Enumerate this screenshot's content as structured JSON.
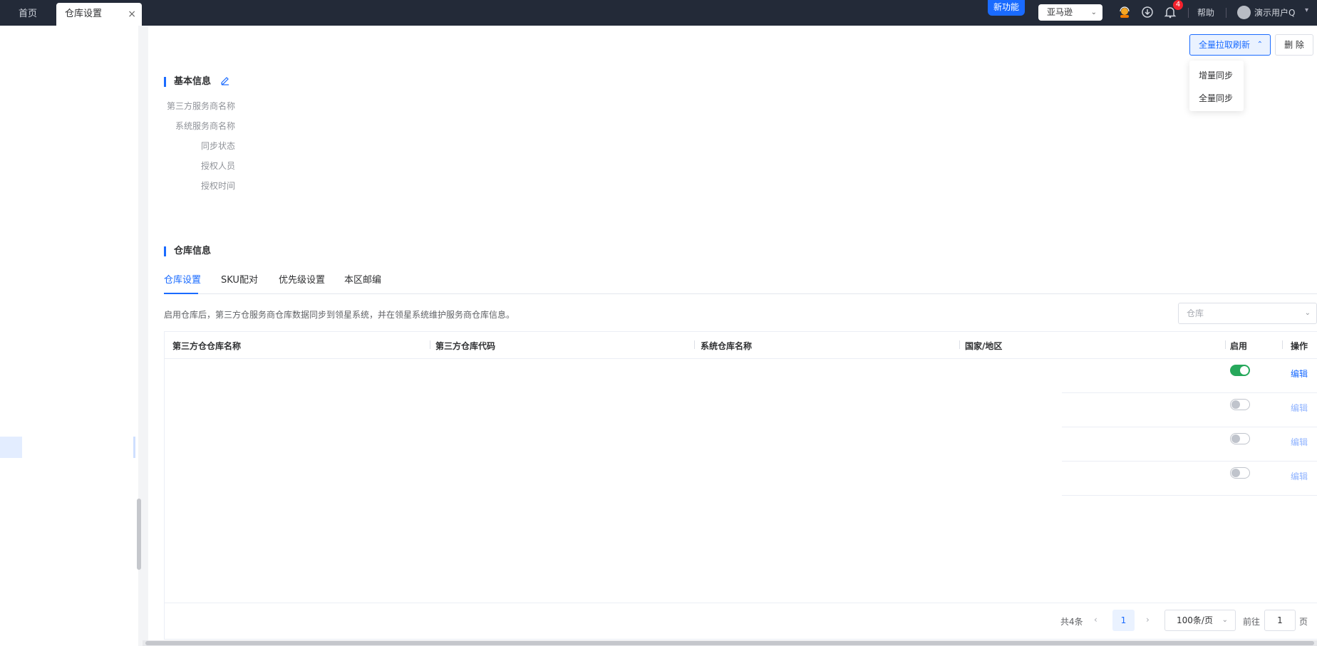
{
  "topbar": {
    "tabs": [
      {
        "label": "首页"
      },
      {
        "label": "仓库设置",
        "close": "×"
      }
    ],
    "new_feature": "新功能",
    "platform": {
      "label": "亚马逊"
    },
    "notification_count": "4",
    "help": "帮助",
    "user": "演示用户Q"
  },
  "actions": {
    "refresh_label": "全量拉取刷新",
    "delete_label": "删 除",
    "dropdown": [
      "增量同步",
      "全量同步"
    ]
  },
  "basic_info": {
    "title": "基本信息",
    "fields": [
      "第三方服务商名称",
      "系统服务商名称",
      "同步状态",
      "授权人员",
      "授权时间"
    ]
  },
  "warehouse_info": {
    "title": "仓库信息",
    "tabs": [
      "仓库设置",
      "SKU配对",
      "优先级设置",
      "本区邮编"
    ],
    "active_tab": 0,
    "hint": "启用仓库后，第三方仓服务商仓库数据同步到领星系统，并在领星系统维护服务商仓库信息。",
    "select_placeholder": "仓库",
    "columns": [
      "第三方仓仓库名称",
      "第三方仓库代码",
      "系统仓库名称",
      "国家/地区",
      "启用",
      "操作"
    ],
    "rows": [
      {
        "enabled": true,
        "action": "编辑"
      },
      {
        "enabled": false,
        "action": "编辑"
      },
      {
        "enabled": false,
        "action": "编辑"
      },
      {
        "enabled": false,
        "action": "编辑"
      }
    ]
  },
  "pagination": {
    "total": "共4条",
    "current_page": "1",
    "page_size": "100条/页",
    "goto_label": "前往",
    "goto_value": "1",
    "page_suffix": "页"
  },
  "colors": {
    "accent": "#1a6bff",
    "topbar": "#232a38",
    "toggle_on": "#26a85b"
  }
}
